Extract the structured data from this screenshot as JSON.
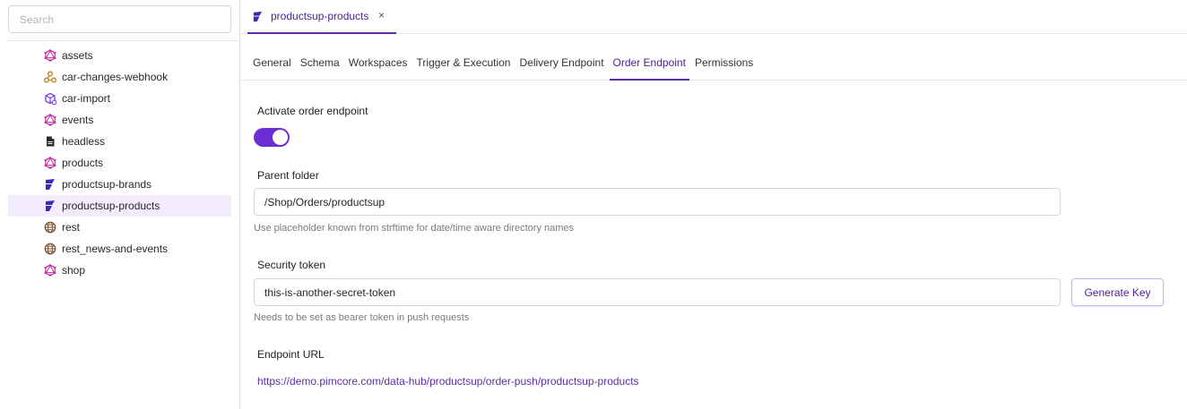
{
  "colors": {
    "accent": "#6a2ed3",
    "accent_dark": "#4a1f8f",
    "selected_bg": "#f4ecfd"
  },
  "search": {
    "placeholder": "Search",
    "value": ""
  },
  "tree": {
    "items": [
      {
        "label": "assets",
        "icon": "graphql-icon"
      },
      {
        "label": "car-changes-webhook",
        "icon": "webhook-icon"
      },
      {
        "label": "car-import",
        "icon": "cube-import-icon"
      },
      {
        "label": "events",
        "icon": "graphql-icon"
      },
      {
        "label": "headless",
        "icon": "document-icon"
      },
      {
        "label": "products",
        "icon": "graphql-icon"
      },
      {
        "label": "productsup-brands",
        "icon": "productsup-icon"
      },
      {
        "label": "productsup-products",
        "icon": "productsup-icon",
        "selected": true
      },
      {
        "label": "rest",
        "icon": "globe-icon"
      },
      {
        "label": "rest_news-and-events",
        "icon": "globe-icon"
      },
      {
        "label": "shop",
        "icon": "graphql-icon"
      }
    ]
  },
  "doc_tab": {
    "label": "productsup-products",
    "icon": "productsup-icon",
    "close": "×"
  },
  "settings_tabs": [
    {
      "label": "General"
    },
    {
      "label": "Schema"
    },
    {
      "label": "Workspaces"
    },
    {
      "label": "Trigger & Execution"
    },
    {
      "label": "Delivery Endpoint"
    },
    {
      "label": "Order Endpoint",
      "active": true
    },
    {
      "label": "Permissions"
    }
  ],
  "form": {
    "activate_label": "Activate order endpoint",
    "activate_on": true,
    "parent_folder_label": "Parent folder",
    "parent_folder_value": "/Shop/Orders/productsup",
    "parent_folder_hint": "Use placeholder known from strftime for date/time aware directory names",
    "security_token_label": "Security token",
    "security_token_value": "this-is-another-secret-token",
    "security_token_hint": "Needs to be set as bearer token in push requests",
    "generate_key_label": "Generate Key",
    "endpoint_url_label": "Endpoint URL",
    "endpoint_url": "https://demo.pimcore.com/data-hub/productsup/order-push/productsup-products"
  }
}
